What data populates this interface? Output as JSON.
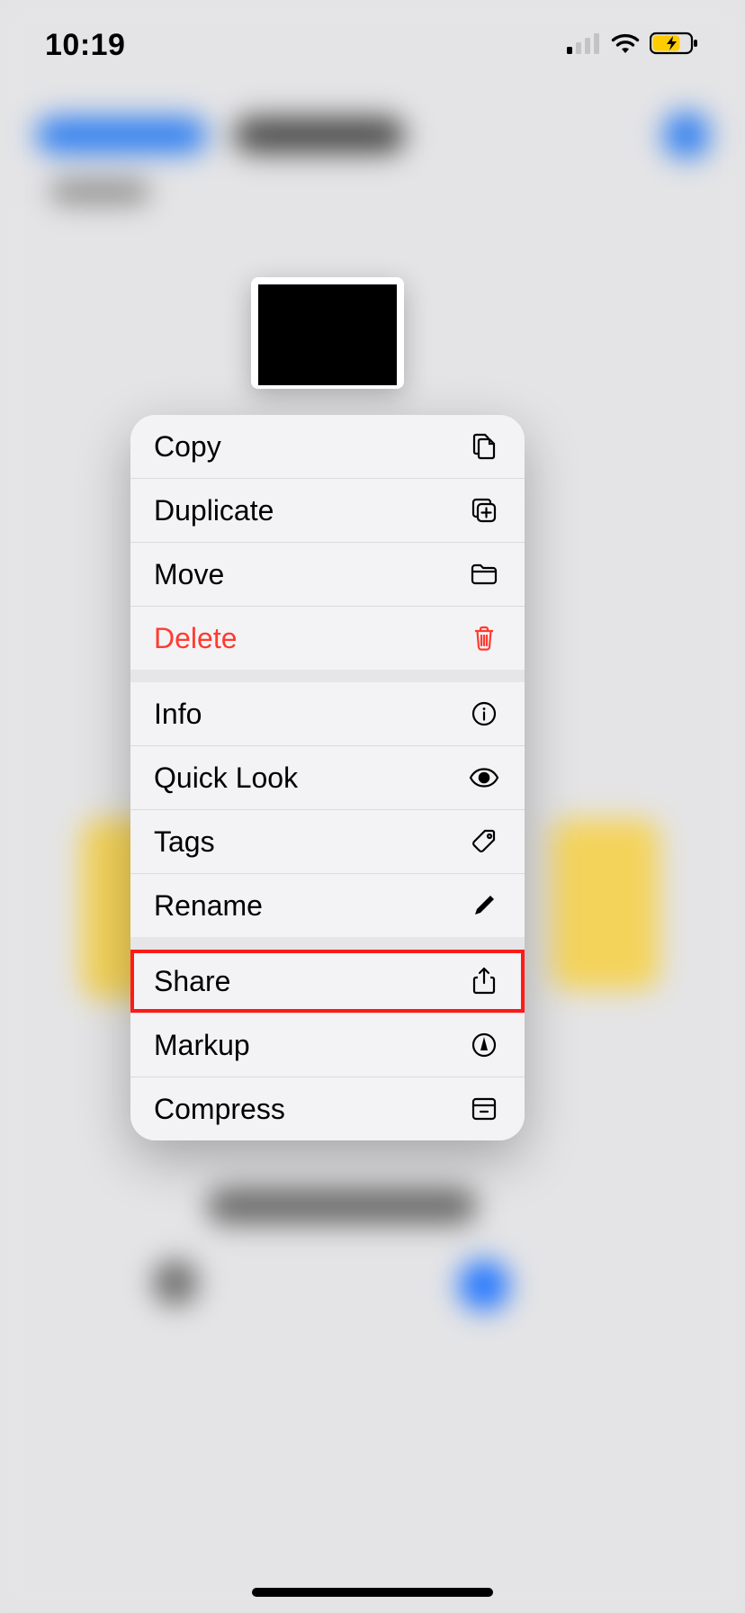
{
  "status": {
    "time": "10:19"
  },
  "menu": {
    "groups": [
      {
        "items": [
          {
            "key": "copy",
            "label": "Copy",
            "icon": "copy-icon",
            "destructive": false
          },
          {
            "key": "duplicate",
            "label": "Duplicate",
            "icon": "duplicate-icon",
            "destructive": false
          },
          {
            "key": "move",
            "label": "Move",
            "icon": "folder-icon",
            "destructive": false
          },
          {
            "key": "delete",
            "label": "Delete",
            "icon": "trash-icon",
            "destructive": true
          }
        ]
      },
      {
        "items": [
          {
            "key": "info",
            "label": "Info",
            "icon": "info-icon",
            "destructive": false
          },
          {
            "key": "quicklook",
            "label": "Quick Look",
            "icon": "eye-icon",
            "destructive": false
          },
          {
            "key": "tags",
            "label": "Tags",
            "icon": "tag-icon",
            "destructive": false
          },
          {
            "key": "rename",
            "label": "Rename",
            "icon": "pencil-icon",
            "destructive": false
          }
        ]
      },
      {
        "items": [
          {
            "key": "share",
            "label": "Share",
            "icon": "share-icon",
            "destructive": false,
            "highlighted": true
          },
          {
            "key": "markup",
            "label": "Markup",
            "icon": "markup-icon",
            "destructive": false
          },
          {
            "key": "compress",
            "label": "Compress",
            "icon": "archive-icon",
            "destructive": false
          }
        ]
      }
    ]
  },
  "highlight_key": "share",
  "colors": {
    "destructive": "#ff3b30",
    "highlight": "#ff1a1a"
  }
}
